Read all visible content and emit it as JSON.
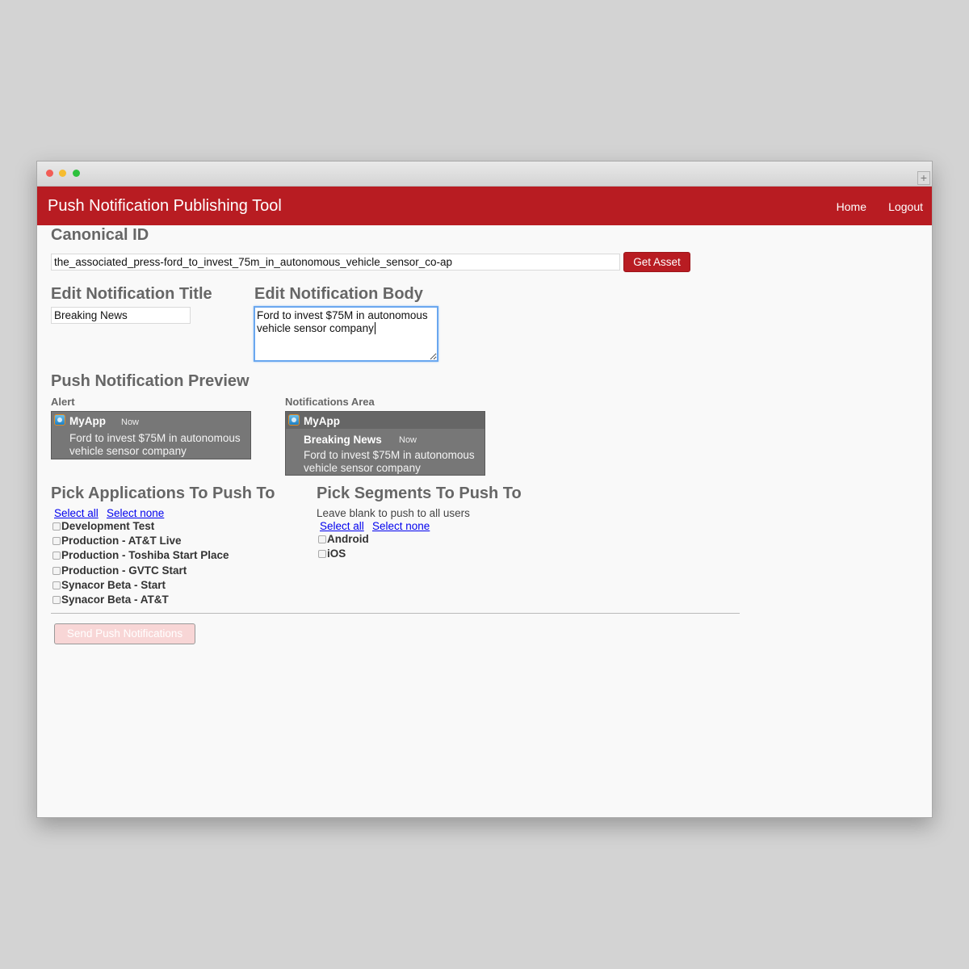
{
  "navbar": {
    "brand": "Push Notification Publishing Tool",
    "links": [
      "Home",
      "Logout"
    ]
  },
  "canonical": {
    "heading": "Canonical ID",
    "value": "the_associated_press-ford_to_invest_75m_in_autonomous_vehicle_sensor_co-ap",
    "button": "Get Asset"
  },
  "edit_title": {
    "heading": "Edit Notification Title",
    "value": "Breaking News"
  },
  "edit_body": {
    "heading": "Edit Notification Body",
    "value": "Ford to invest $75M in autonomous vehicle sensor company"
  },
  "preview": {
    "heading": "Push Notification Preview",
    "alert": {
      "label": "Alert",
      "app_name": "MyApp",
      "time": "Now",
      "line1": "Ford to invest $75M in autonomous",
      "line2": "vehicle sensor company"
    },
    "area": {
      "label": "Notifications Area",
      "app_name": "MyApp",
      "title": "Breaking News",
      "time": "Now",
      "line1": "Ford to invest $75M in autonomous",
      "line2": "vehicle sensor company"
    }
  },
  "applications": {
    "heading": "Pick Applications To Push To",
    "select_all": "Select all",
    "select_none": "Select none",
    "items": [
      "Development Test",
      "Production - AT&T Live",
      "Production - Toshiba Start Place",
      "Production - GVTC Start",
      "Synacor Beta - Start",
      "Synacor Beta - AT&T"
    ]
  },
  "segments": {
    "heading": "Pick Segments To Push To",
    "hint": "Leave blank to push to all users",
    "select_all": "Select all",
    "select_none": "Select none",
    "items": [
      "Android",
      "iOS"
    ]
  },
  "send_button": "Send Push Notifications",
  "colors": {
    "brand_red": "#b81c22",
    "focus_blue": "#6aa7ef",
    "disabled_send_bg": "#f8d6d6"
  }
}
